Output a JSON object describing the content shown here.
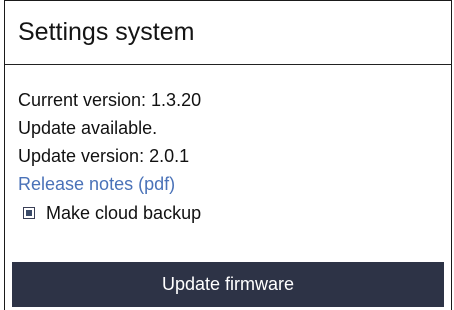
{
  "panel": {
    "title": "Settings system"
  },
  "info": {
    "current_version": "Current version: 1.3.20",
    "update_status": "Update available.",
    "update_version": "Update version: 2.0.1"
  },
  "release_notes": {
    "label": "Release notes (pdf)"
  },
  "cloud_backup": {
    "label": "Make cloud backup",
    "checked": true
  },
  "actions": {
    "update_label": "Update firmware"
  },
  "colors": {
    "button_bg": "#2d3346",
    "link": "#4a72b8",
    "border": "#1a1a1a"
  }
}
